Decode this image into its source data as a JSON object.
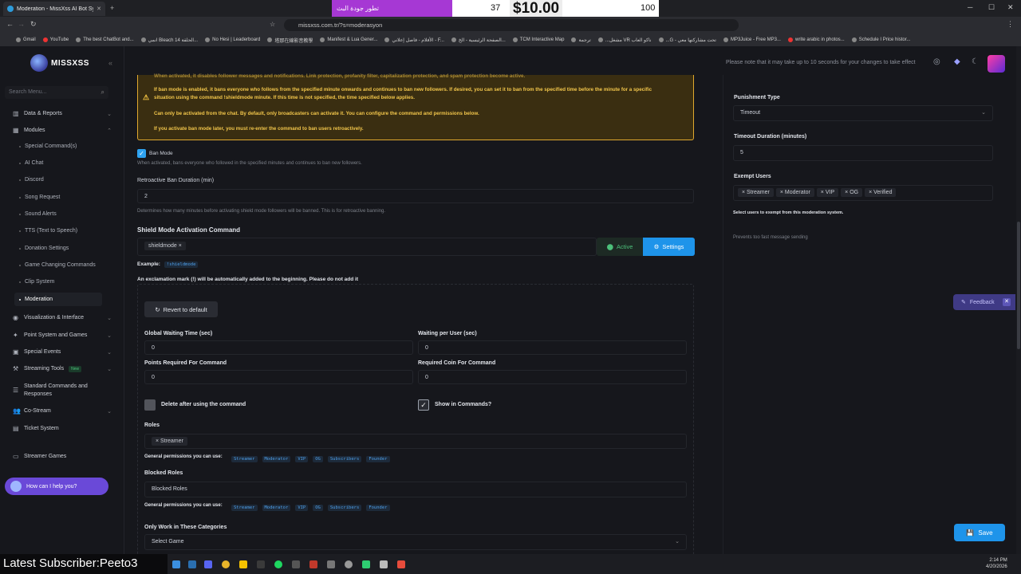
{
  "browser": {
    "tab_title": "Moderation - MissXss AI Bot Syste",
    "url": "missxss.com.tr/?s=moderasyon",
    "bookmarks": [
      "Gmail",
      "YouTube",
      "The best ChatBot and...",
      "انمي Bleach الحلقة 14...",
      "No Hesi | Leaderboard",
      "塔那在線影音教學",
      "Manifest & Lua Gener...",
      "الأفلام - فاصل إعلاني - F...",
      "الصفحة الرئيسية - الخ...",
      "TCM Interactive Map",
      "ترجمة",
      "...مشغل VR ناكو العاب",
      "...G - تحت مشاركتها معي",
      "MP3Juice - Free MP3...",
      "write arabic in photos...",
      "Schedule I Price histor..."
    ]
  },
  "stream_overlay": {
    "banner_text": "تطور جودة البث",
    "counter_left": "37",
    "counter_right": "100",
    "price": "$10.00",
    "ticker": "Latest Subscriber:Peeto3"
  },
  "app": {
    "logo_text": "MISSXSS",
    "top_note": "Please note that it may take up to 10 seconds for your changes to take effect"
  },
  "sidebar": {
    "search_placeholder": "Search Menu...",
    "items": [
      {
        "label": "Data & Reports",
        "icon": "chart-icon"
      },
      {
        "label": "Modules",
        "icon": "grid-icon"
      },
      {
        "label": "Special Command(s)"
      },
      {
        "label": "AI Chat"
      },
      {
        "label": "Discord"
      },
      {
        "label": "Song Request"
      },
      {
        "label": "Sound Alerts"
      },
      {
        "label": "TTS (Text to Speech)"
      },
      {
        "label": "Donation Settings"
      },
      {
        "label": "Game Changing Commands"
      },
      {
        "label": "Clip System"
      },
      {
        "label": "Moderation"
      },
      {
        "label": "Visualization & Interface"
      },
      {
        "label": "Point System and Games"
      },
      {
        "label": "Special Events"
      },
      {
        "label": "Streaming Tools",
        "badge": "New"
      },
      {
        "label": "Standard Commands and Responses"
      },
      {
        "label": "Co-Stream"
      },
      {
        "label": "Ticket System"
      },
      {
        "label": "Streamer Games"
      }
    ],
    "help_label": "How can I help you?"
  },
  "main": {
    "warning_lines": [
      "When activated, it disables follower messages and notifications. Link protection, profanity filter, capitalization protection, and spam protection become active.",
      "If ban mode is enabled, it bans everyone who follows from the specified minute onwards and continues to ban new followers. If desired, you can set it to ban from the specified time before the minute for a specific",
      "situation using the command !shieldmode minute. If this time is not specified, the time specified below applies.",
      "Can only be activated from the chat. By default, only broadcasters can activate it. You can configure the command and permissions below.",
      "If you activate ban mode later, you must re-enter the command to ban users retroactively."
    ],
    "ban_mode_label": "Ban Mode",
    "ban_mode_hint": "When activated, bans everyone who followed in the specified minutes and continues to ban new followers.",
    "retro_label": "Retroactive Ban Duration (min)",
    "retro_value": "2",
    "retro_hint": "Determines how many minutes before activating shield mode followers will be banned. This is for retroactive banning.",
    "shield_title": "Shield Mode Activation Command",
    "shield_chip": "shieldmode",
    "active_label": "Active",
    "settings_label": "Settings",
    "example_label": "Example:",
    "example_code": "!shieldmode",
    "excl_note": "An exclamation mark (!) will be automatically added to the beginning. Please do not add it",
    "revert_label": "Revert to default",
    "global_wait_label": "Global Waiting Time (sec)",
    "global_wait_value": "0",
    "per_user_label": "Waiting per User (sec)",
    "per_user_value": "0",
    "points_label": "Points Required For Command",
    "points_value": "0",
    "coin_label": "Required Coin For Command",
    "coin_value": "0",
    "delete_label": "Delete after using the command",
    "show_label": "Show in Commands?",
    "roles_label": "Roles",
    "roles_chip": "Streamer",
    "perm_label": "General permissions you can use:",
    "perm_codes": [
      "Streamer",
      "Moderator",
      "VIP",
      "OG",
      "Subscribers",
      "Founder"
    ],
    "blocked_label": "Blocked Roles",
    "blocked_placeholder": "Blocked Roles",
    "categories_label": "Only Work in These Categories",
    "categories_placeholder": "Select Game"
  },
  "right": {
    "punish_label": "Punishment Type",
    "punish_value": "Timeout",
    "timeout_label": "Timeout Duration (minutes)",
    "timeout_value": "5",
    "exempt_label": "Exempt Users",
    "exempt_chips": [
      "Streamer",
      "Moderator",
      "VIP",
      "OG",
      "Verified"
    ],
    "exempt_hint": "Select users to exempt from this moderation system.",
    "spam_hint": "Prevents too fast message sending"
  },
  "feedback_label": "Feedback",
  "save_label": "Save",
  "clock": {
    "time": "2:14 PM",
    "date": "4/20/2026"
  },
  "colors": {
    "accent": "#1e94ea",
    "warning": "#e0a82e",
    "help": "#6a49d8"
  }
}
